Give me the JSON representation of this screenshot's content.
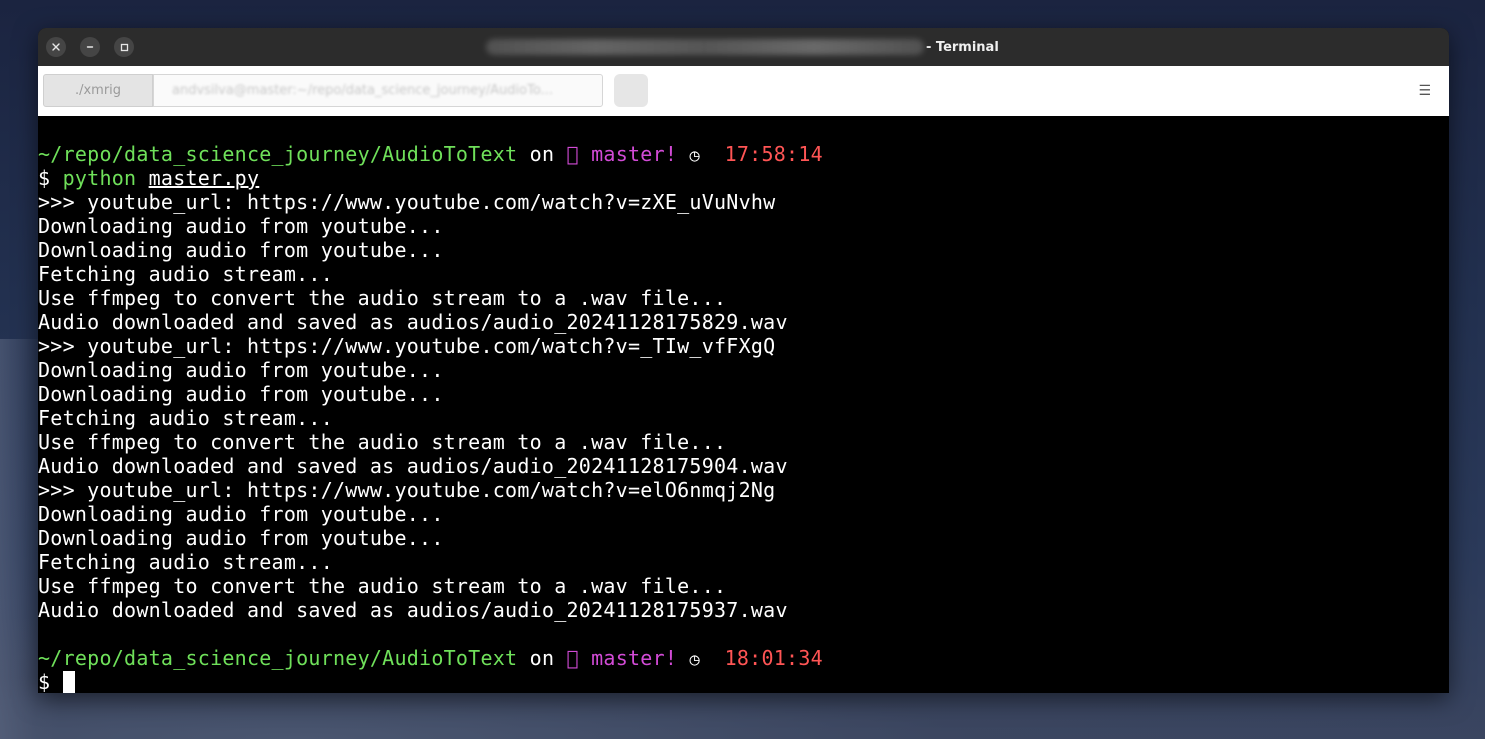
{
  "window": {
    "title": "- Terminal"
  },
  "tabs": [
    {
      "label": "./xmrig"
    },
    {
      "label": "andvsilva@master:~/repo/data_science_journey/AudioTo..."
    }
  ],
  "prompt1": {
    "path": "~/repo/data_science_journey/AudioToText",
    "on": "on",
    "branch_icon": "",
    "branch": "master!",
    "clock_icon": "◷",
    "time": "17:58:14",
    "symbol": "$",
    "command": "python",
    "argument": "master.py"
  },
  "output": [
    ">>> youtube_url: https://www.youtube.com/watch?v=zXE_uVuNvhw",
    "Downloading audio from youtube...",
    "Downloading audio from youtube...",
    "Fetching audio stream...",
    "Use ffmpeg to convert the audio stream to a .wav file...",
    "Audio downloaded and saved as audios/audio_20241128175829.wav",
    ">>> youtube_url: https://www.youtube.com/watch?v=_TIw_vfFXgQ",
    "Downloading audio from youtube...",
    "Downloading audio from youtube...",
    "Fetching audio stream...",
    "Use ffmpeg to convert the audio stream to a .wav file...",
    "Audio downloaded and saved as audios/audio_20241128175904.wav",
    ">>> youtube_url: https://www.youtube.com/watch?v=elO6nmqj2Ng",
    "Downloading audio from youtube...",
    "Downloading audio from youtube...",
    "Fetching audio stream...",
    "Use ffmpeg to convert the audio stream to a .wav file...",
    "Audio downloaded and saved as audios/audio_20241128175937.wav"
  ],
  "prompt2": {
    "path": "~/repo/data_science_journey/AudioToText",
    "on": "on",
    "branch_icon": "",
    "branch": "master!",
    "clock_icon": "◷",
    "time": "18:01:34",
    "symbol": "$"
  },
  "colors": {
    "path": "#6fe05a",
    "branch": "#d24bd6",
    "time": "#ff5555",
    "command": "#6fe05a",
    "background": "#000000",
    "titlebar": "#2c2c2c"
  },
  "icons": {
    "close": "close-icon",
    "minimize": "minimize-icon",
    "maximize": "maximize-icon",
    "menu": "hamburger-menu-icon"
  }
}
